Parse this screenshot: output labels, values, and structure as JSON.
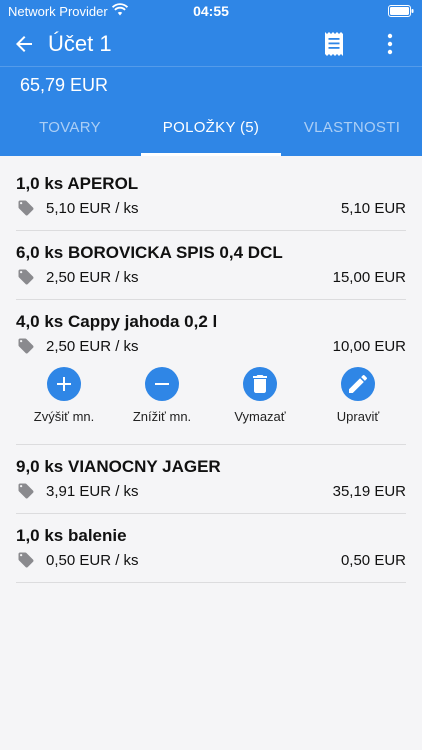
{
  "status": {
    "carrier": "Network Provider",
    "time": "04:55"
  },
  "header": {
    "title": "Účet 1"
  },
  "total_amount": "65,79 EUR",
  "tabs": [
    {
      "label": "TOVARY"
    },
    {
      "label": "POLOŽKY (5)"
    },
    {
      "label": "VLASTNOSTI"
    }
  ],
  "items": [
    {
      "name": "1,0 ks APEROL",
      "unit_price": "5,10 EUR / ks",
      "total": "5,10 EUR"
    },
    {
      "name": "6,0 ks BOROVICKA SPIS 0,4 DCL",
      "unit_price": "2,50 EUR / ks",
      "total": "15,00 EUR"
    },
    {
      "name": "4,0 ks Cappy jahoda 0,2 l",
      "unit_price": "2,50 EUR / ks",
      "total": "10,00 EUR"
    },
    {
      "name": "9,0 ks VIANOCNY JAGER",
      "unit_price": "3,91 EUR / ks",
      "total": "35,19 EUR"
    },
    {
      "name": "1,0 ks balenie",
      "unit_price": "0,50 EUR / ks",
      "total": "0,50 EUR"
    }
  ],
  "item_actions": {
    "increase": "Zvýšiť mn.",
    "decrease": "Znížiť mn.",
    "delete": "Vymazať",
    "edit": "Upraviť"
  },
  "colors": {
    "primary": "#2f86e6",
    "background": "#f5f5f7"
  },
  "icons": [
    "wifi-icon",
    "battery-icon",
    "back-arrow-icon",
    "receipt-icon",
    "more-vert-icon",
    "price-tag-icon",
    "plus-icon",
    "minus-icon",
    "trash-icon",
    "pencil-icon"
  ]
}
